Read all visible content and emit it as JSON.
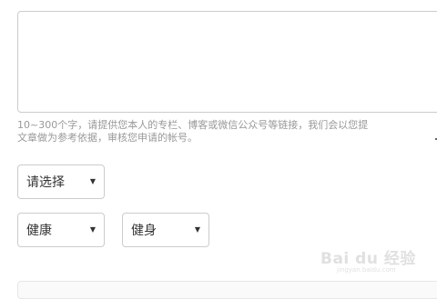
{
  "form": {
    "intro_textarea": {
      "value": "",
      "placeholder": ""
    },
    "intro_hint": "10~300个字，请提供您本人的专栏、博客或微信公众号等链接，我们会以您提\n文章做为参考依据，审核您申请的帐号。",
    "category_select": {
      "selected": "请选择",
      "caret": "▼"
    },
    "area_select_1": {
      "selected": "健康",
      "caret": "▼"
    },
    "area_select_2": {
      "selected": "健身",
      "caret": "▼"
    }
  },
  "watermark": {
    "text": "Bai du 经验",
    "sub": "jingyan.baidu.com"
  },
  "colors": {
    "border": "#cccccc",
    "hint_text": "#999999",
    "text": "#333333"
  }
}
